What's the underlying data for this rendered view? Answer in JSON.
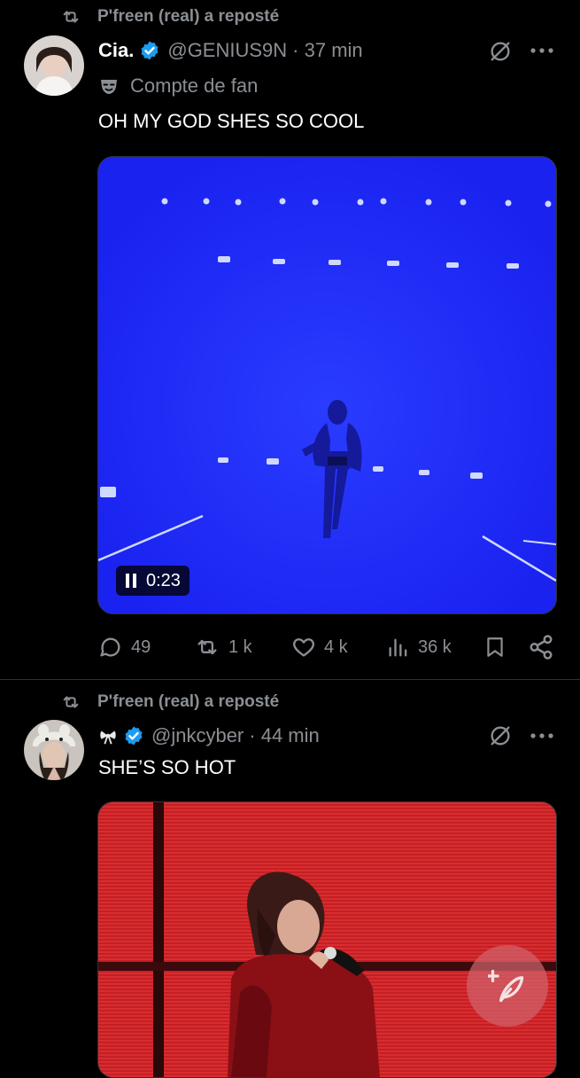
{
  "posts": [
    {
      "repost_label": "P'freen (real) a reposté",
      "display_name": "Cia.",
      "handle": "@GENIUS9N",
      "time": "· 37 min",
      "fan_label": "Compte de fan",
      "text": "OH MY GOD SHES SO COOL",
      "video_time": "0:23",
      "stats": {
        "replies": "49",
        "reposts": "1 k",
        "likes": "4 k",
        "views": "36 k"
      }
    },
    {
      "repost_label": "P'freen (real) a reposté",
      "display_name": "",
      "handle": "@jnkcyber",
      "time": "· 44 min",
      "text": "SHE’S SO HOT"
    }
  ],
  "icons": {
    "repost": "repost-icon",
    "verified": "verified-badge-icon",
    "grok": "grok-icon",
    "more": "more-icon",
    "reply": "reply-icon",
    "like": "like-icon",
    "views": "views-icon",
    "bookmark": "bookmark-icon",
    "share": "share-icon",
    "compose": "compose-icon"
  },
  "colors": {
    "verified": "#1d9bf0",
    "video_bg": "#1f2cff",
    "video2_bg": "#d0262a",
    "fab": "#d2646e"
  }
}
